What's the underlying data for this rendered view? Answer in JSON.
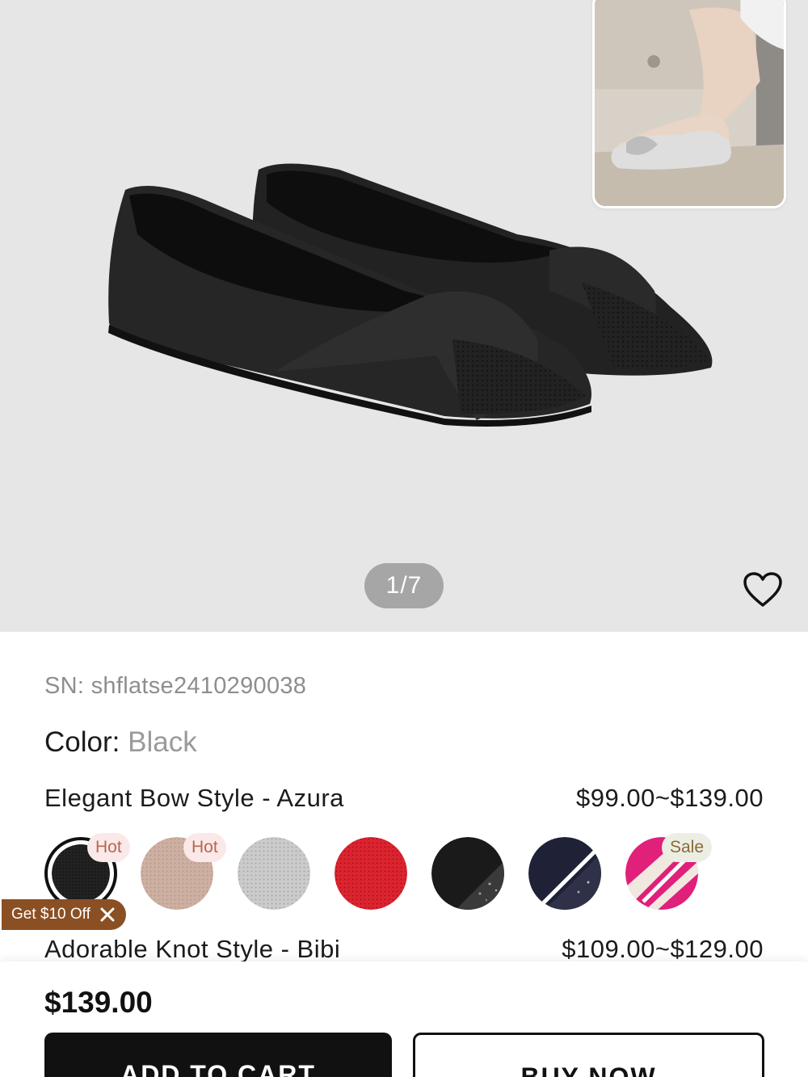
{
  "gallery": {
    "counter": "1/7",
    "wishlist_icon": "heart-outline-icon"
  },
  "product": {
    "sn_label": "SN:",
    "sn_value": "shflatse2410290038",
    "color_label": "Color:",
    "color_value": "Black"
  },
  "styles": [
    {
      "name": "Elegant Bow Style - Azura",
      "price": "$99.00~$139.00",
      "swatches": [
        {
          "name": "black",
          "color": "#1a1a1a",
          "tag": "Hot",
          "selected": true
        },
        {
          "name": "nude",
          "color": "#c9ab9c",
          "tag": "Hot"
        },
        {
          "name": "silver",
          "color": "#c4c4c4"
        },
        {
          "name": "red",
          "color": "#d4202c"
        },
        {
          "name": "black-glitter",
          "color": "#1c1c1c"
        },
        {
          "name": "navy-glitter",
          "color": "#1f2236"
        },
        {
          "name": "pink-stripe",
          "color": "#e0207a",
          "tag": "Sale"
        }
      ]
    },
    {
      "name": "Adorable Knot Style - Bibi",
      "price": "$109.00~$129.00"
    }
  ],
  "coupon": {
    "label": "Get $10 Off"
  },
  "bottom_bar": {
    "total": "$139.00",
    "add_to_cart": "ADD TO CART",
    "buy_now": "BUY NOW"
  }
}
